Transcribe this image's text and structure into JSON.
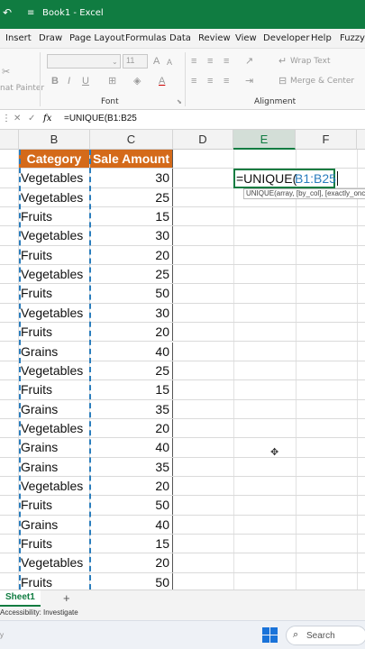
{
  "titlebar": {
    "save_glyph": "↶",
    "more_glyph": "≡",
    "title": "Book1 - Excel"
  },
  "menu": {
    "items": [
      "Insert",
      "Draw",
      "Page Layout",
      "Formulas",
      "Data",
      "Review",
      "View",
      "Developer",
      "Help",
      "Fuzzy L"
    ]
  },
  "ribbon": {
    "font_size": "11",
    "grow_font": "A",
    "shrink_font": "A",
    "bold": "B",
    "italic": "I",
    "underline": "U",
    "font_color_letter": "A",
    "wrap_text": "Wrap Text",
    "merge_center": "Merge & Center",
    "format_painter": "nat Painter",
    "font_group": "Font",
    "alignment_group": "Alignment"
  },
  "formula_bar": {
    "cancel": "✕",
    "enter": "✓",
    "fx": "fx",
    "content": "=UNIQUE(B1:B25"
  },
  "columns": [
    "B",
    "C",
    "D",
    "E",
    "F"
  ],
  "table": {
    "headers": [
      "Category",
      "Sale Amount"
    ],
    "rows": [
      [
        "Vegetables",
        "30"
      ],
      [
        "Vegetables",
        "25"
      ],
      [
        "Fruits",
        "15"
      ],
      [
        "Vegetables",
        "30"
      ],
      [
        "Fruits",
        "20"
      ],
      [
        "Vegetables",
        "25"
      ],
      [
        "Fruits",
        "50"
      ],
      [
        "Vegetables",
        "30"
      ],
      [
        "Fruits",
        "20"
      ],
      [
        "Grains",
        "40"
      ],
      [
        "Vegetables",
        "25"
      ],
      [
        "Fruits",
        "15"
      ],
      [
        "Grains",
        "35"
      ],
      [
        "Vegetables",
        "20"
      ],
      [
        "Grains",
        "40"
      ],
      [
        "Grains",
        "35"
      ],
      [
        "Vegetables",
        "20"
      ],
      [
        "Fruits",
        "50"
      ],
      [
        "Grains",
        "40"
      ],
      [
        "Fruits",
        "15"
      ],
      [
        "Vegetables",
        "20"
      ],
      [
        "Fruits",
        "50"
      ]
    ]
  },
  "edit_cell": {
    "prefix": "=UNIQUE(",
    "ref": "B1:B25"
  },
  "tooltip": {
    "text": "UNIQUE(array, [by_col], [exactly_once])"
  },
  "sheet": {
    "tab": "Sheet1",
    "add": "+"
  },
  "status": {
    "accessibility": "Accessibility: Investigate"
  },
  "taskbar": {
    "search_placeholder": "Search"
  },
  "colors": {
    "excel_green": "#107c41",
    "header_orange": "#d46a1a",
    "selection_blue": "#2a7dbd"
  }
}
